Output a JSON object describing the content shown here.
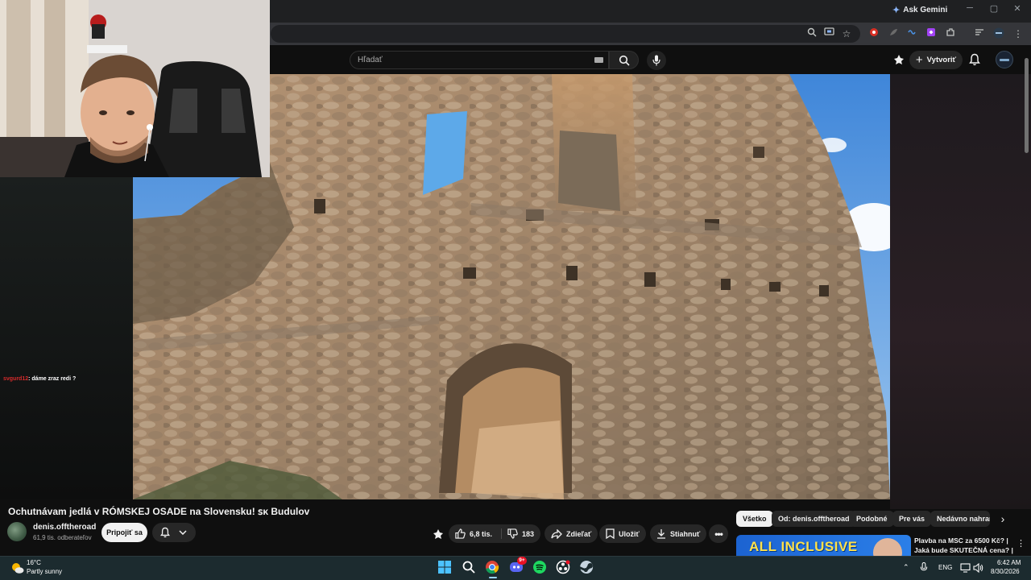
{
  "browser": {
    "ask_gemini": "Ask Gemini"
  },
  "youtube": {
    "search": {
      "placeholder": "Hľadať"
    },
    "create_label": "Vytvoriť"
  },
  "stream_overlay": {
    "chat_user": "svgurd12",
    "chat_message": ": dáme zraz redi ?"
  },
  "video": {
    "title": "Ochutnávam jedlá v RÓMSKEJ OSADE na Slovensku! ꜱᴋ Budulov",
    "channel_name": "denis.offtheroad",
    "subscribers": "61,9 tis. odberateľov",
    "join_label": "Pripojiť sa",
    "likes": "6,8 tis.",
    "dislikes": "183",
    "share_label": "Zdieľať",
    "save_label": "Uložiť",
    "download_label": "Stiahnuť"
  },
  "filter_chips": [
    "Všetko",
    "Od: denis.offtheroad",
    "Podobné",
    "Pre vás",
    "Nedávno nahrané"
  ],
  "recommendation": {
    "thumb_text": "ALL INCLUSIVE",
    "title": "Plavba na MSC za 6500 Kč? | Jaká bude SKUTEČNÁ cena? |"
  },
  "taskbar": {
    "temperature": "16°C",
    "condition": "Partly sunny",
    "language": "ENG",
    "time": "6:42 AM",
    "date": "8/30/2026",
    "discord_badge": "9+"
  },
  "colors": {
    "youtube_bg": "#0f0f0f",
    "chip_active": "#f1f1f1",
    "taskbar": "#1c2b2f",
    "chat_user": "#d62b2b"
  }
}
